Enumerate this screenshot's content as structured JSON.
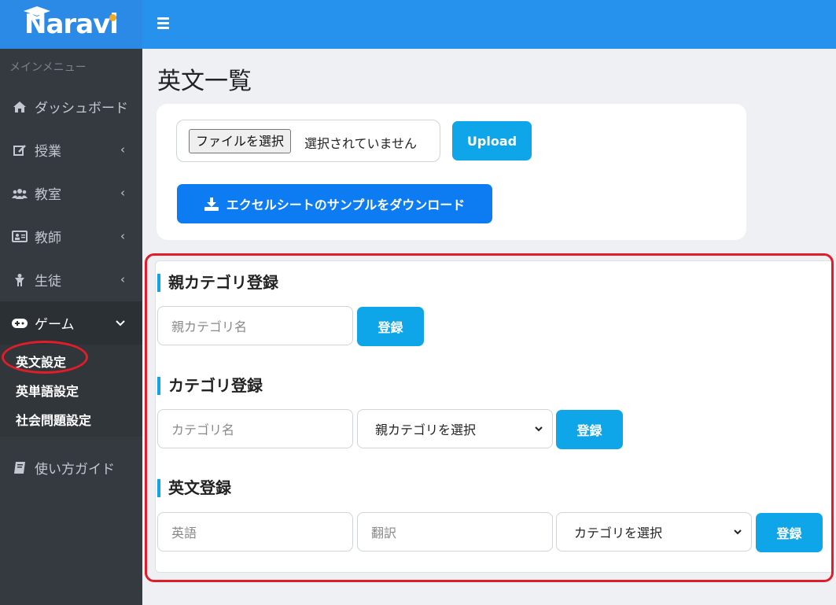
{
  "brand": {
    "name": "Naravi",
    "accent": "#f5a623"
  },
  "sidebar": {
    "header": "メインメニュー",
    "items": [
      {
        "label": "ダッシュボード",
        "icon": "home-icon"
      },
      {
        "label": "授業",
        "icon": "edit-icon"
      },
      {
        "label": "教室",
        "icon": "users-icon"
      },
      {
        "label": "教師",
        "icon": "id-card-icon"
      },
      {
        "label": "生徒",
        "icon": "child-icon"
      },
      {
        "label": "ゲーム",
        "icon": "gamepad-icon"
      }
    ],
    "submenu": [
      "英文設定",
      "英単語設定",
      "社会問題設定"
    ],
    "guide": {
      "label": "使い方ガイド",
      "icon": "book-icon"
    }
  },
  "main": {
    "title": "英文一覧",
    "upload": {
      "file_button": "ファイルを選択",
      "file_status": "選択されていません",
      "upload_label": "Upload",
      "download_label": "エクセルシートのサンプルをダウンロード"
    },
    "parent_category": {
      "title": "親カテゴリ登録",
      "name_placeholder": "親カテゴリ名",
      "register_label": "登録"
    },
    "category": {
      "title": "カテゴリ登録",
      "name_placeholder": "カテゴリ名",
      "parent_select": "親カテゴリを選択",
      "register_label": "登録"
    },
    "sentence": {
      "title": "英文登録",
      "english_placeholder": "英語",
      "translation_placeholder": "翻訳",
      "category_select": "カテゴリを選択",
      "register_label": "登録"
    }
  },
  "colors": {
    "topbar": "#2792ee",
    "primary": "#0d7bf2",
    "info": "#0ea5e9",
    "sidebar": "#343a40",
    "highlight": "#e11d2a"
  }
}
